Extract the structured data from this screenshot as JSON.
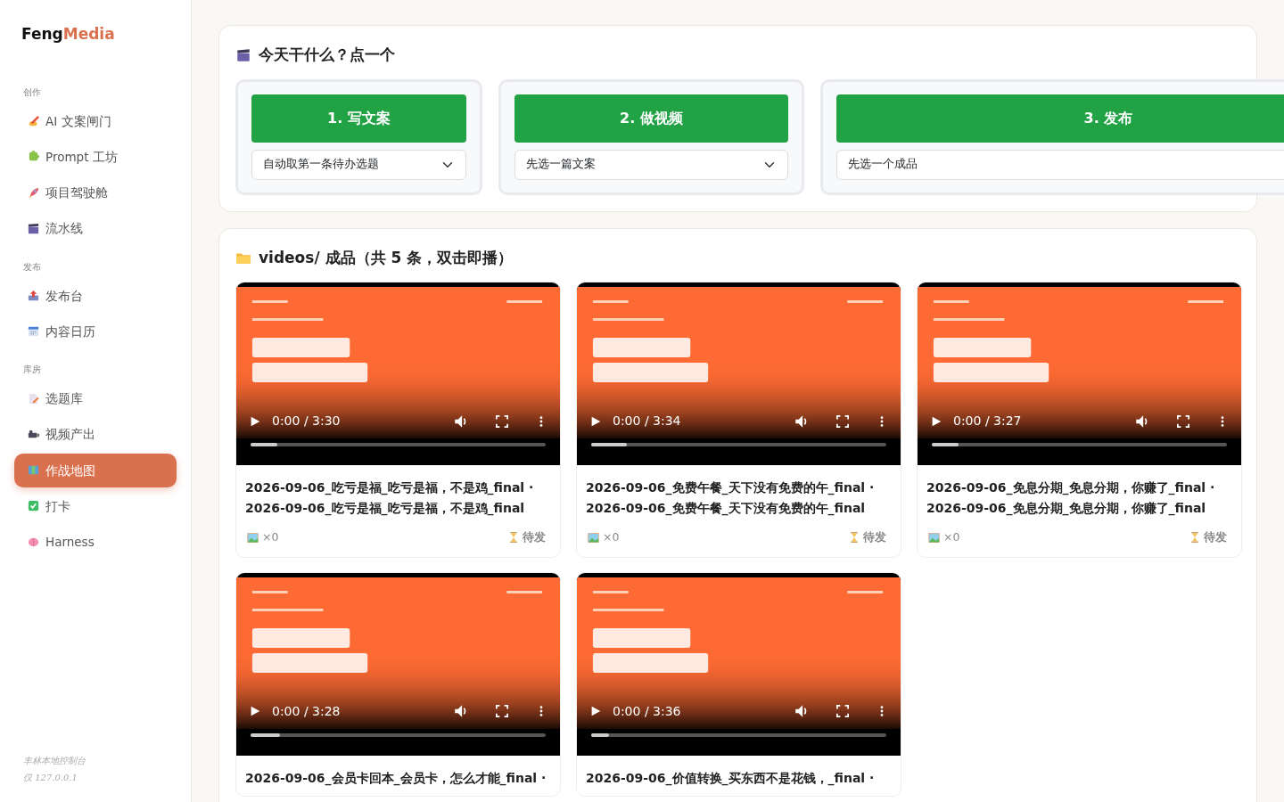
{
  "sidebar": {
    "logo": {
      "main": "Feng",
      "accent": "Media"
    },
    "sections": [
      {
        "label": "创作",
        "items": [
          {
            "label": "AI 文案闸门",
            "selected": false
          },
          {
            "label": "Prompt 工坊",
            "selected": false
          },
          {
            "label": "项目驾驶舱",
            "selected": false
          },
          {
            "label": "流水线",
            "selected": false
          }
        ]
      },
      {
        "label": "发布",
        "items": [
          {
            "label": "发布台",
            "selected": false
          },
          {
            "label": "内容日历",
            "selected": false
          }
        ]
      },
      {
        "label": "库房",
        "items": [
          {
            "label": "选题库",
            "selected": false
          },
          {
            "label": "视频产出",
            "selected": false
          },
          {
            "label": "作战地图",
            "selected": true
          },
          {
            "label": "打卡",
            "selected": false
          },
          {
            "label": "Harness",
            "selected": false
          }
        ]
      }
    ],
    "footer": [
      "丰林本地控制台",
      "仅 127.0.0.1"
    ]
  },
  "today": {
    "title": "今天干什么？点一个",
    "steps": [
      {
        "kind": "select",
        "button": "1. 写文案",
        "value": "自动取第一条待办选题"
      },
      {
        "kind": "select",
        "button": "2. 做视频",
        "value": "先选一篇文案"
      },
      {
        "kind": "field",
        "button": "3. 发布",
        "value": "先选一个成品"
      }
    ]
  },
  "videos": {
    "title": "videos/ 成品（共 5 条，双击即播）",
    "items": [
      {
        "time": "0:00 / 3:30",
        "level": 0.09,
        "title": "2026-09-06_吃亏是福_吃亏是福，不是鸡_final · 2026-09-06_吃亏是福_吃亏是福，不是鸡_final",
        "count": "×0",
        "status": "待发"
      },
      {
        "time": "0:00 / 3:34",
        "level": 0.12,
        "title": "2026-09-06_免费午餐_天下没有免费的午_final · 2026-09-06_免费午餐_天下没有免费的午_final",
        "count": "×0",
        "status": "待发"
      },
      {
        "time": "0:00 / 3:27",
        "level": 0.09,
        "title": "2026-09-06_免息分期_免息分期，你赚了_final · 2026-09-06_免息分期_免息分期，你赚了_final",
        "count": "×0",
        "status": "待发"
      },
      {
        "time": "0:00 / 3:28",
        "level": 0.1,
        "title": "2026-09-06_会员卡回本_会员卡，怎么才能_final ·"
      },
      {
        "time": "0:00 / 3:36",
        "level": 0.06,
        "title": "2026-09-06_价值转换_买东西不是花钱，_final ·"
      }
    ]
  }
}
